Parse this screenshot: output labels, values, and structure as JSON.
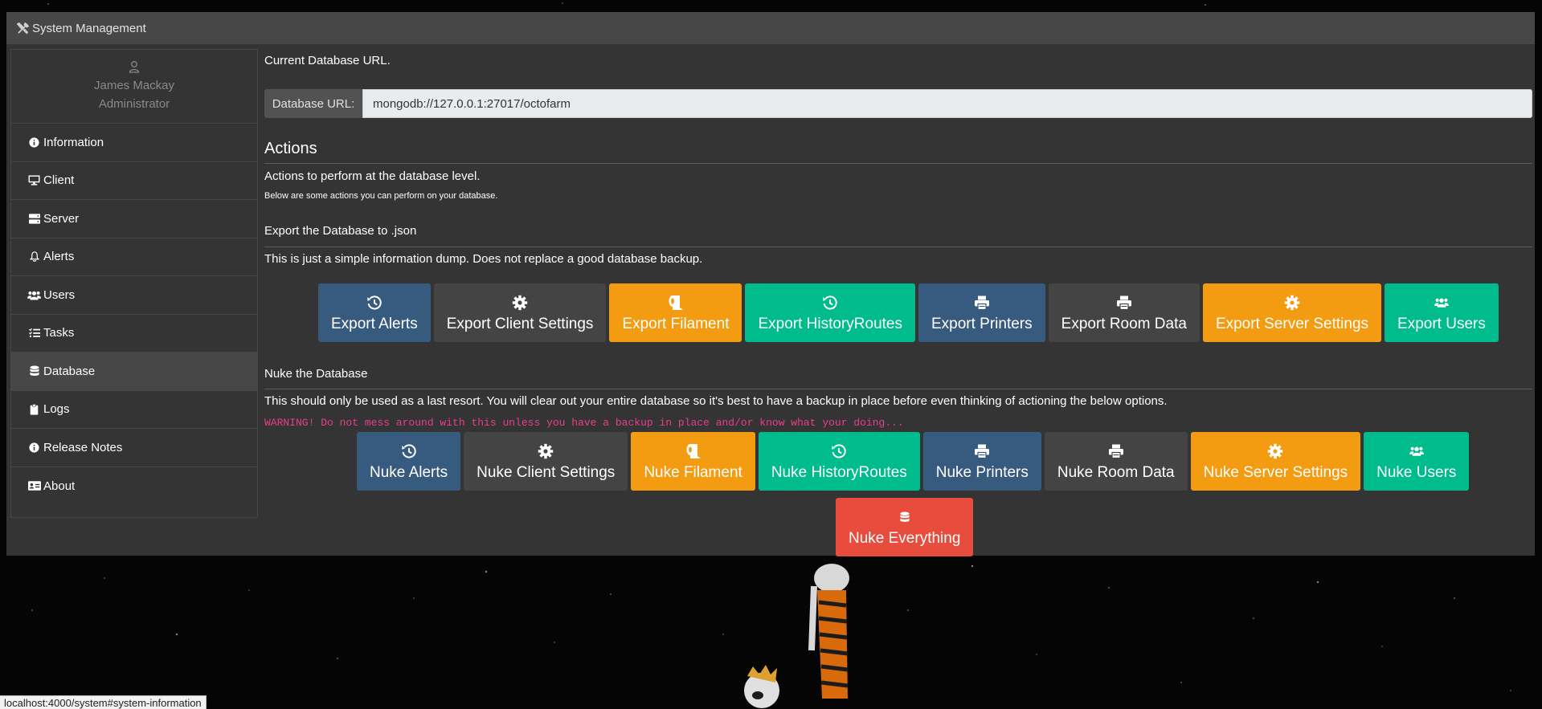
{
  "modal": {
    "title": "System Management",
    "title_icon": "tools-icon"
  },
  "profile": {
    "name": "James Mackay",
    "role": "Administrator",
    "icon": "user-icon"
  },
  "sidebar": {
    "items": [
      {
        "label": "Information",
        "icon": "info-circle-icon"
      },
      {
        "label": "Client",
        "icon": "desktop-icon"
      },
      {
        "label": "Server",
        "icon": "server-icon"
      },
      {
        "label": "Alerts",
        "icon": "bell-icon"
      },
      {
        "label": "Users",
        "icon": "users-icon"
      },
      {
        "label": "Tasks",
        "icon": "tasks-icon"
      },
      {
        "label": "Database",
        "icon": "database-icon",
        "active": true
      },
      {
        "label": "Logs",
        "icon": "clipboard-icon"
      },
      {
        "label": "Release Notes",
        "icon": "info-circle-icon"
      },
      {
        "label": "About",
        "icon": "id-card-icon"
      }
    ]
  },
  "database": {
    "current_url_label": "Current Database URL.",
    "prefix": "Database URL:",
    "url": "mongodb://127.0.0.1:27017/octofarm"
  },
  "actions": {
    "heading": "Actions",
    "subheading": "Actions to perform at the database level.",
    "note": "Below are some actions you can perform on your database."
  },
  "export": {
    "heading": "Export the Database to .json",
    "description": "This is just a simple information dump. Does not replace a good database backup.",
    "buttons": [
      {
        "label": "Export Alerts",
        "icon": "history-icon",
        "color": "#375a7f"
      },
      {
        "label": "Export Client Settings",
        "icon": "cog-icon",
        "color": "#444444"
      },
      {
        "label": "Export Filament",
        "icon": "toilet-paper-icon",
        "color": "#f39c12"
      },
      {
        "label": "Export HistoryRoutes",
        "icon": "history-icon",
        "color": "#00bc8c"
      },
      {
        "label": "Export Printers",
        "icon": "print-icon",
        "color": "#375a7f"
      },
      {
        "label": "Export Room Data",
        "icon": "print-icon",
        "color": "#444444"
      },
      {
        "label": "Export Server Settings",
        "icon": "cog-icon",
        "color": "#f39c12"
      },
      {
        "label": "Export Users",
        "icon": "users-icon",
        "color": "#00bc8c"
      }
    ]
  },
  "nuke": {
    "heading": "Nuke the Database",
    "description": "This should only be used as a last resort. You will clear out your entire database so it's best to have a backup in place before even thinking of actioning the below options.",
    "warning": "WARNING! Do not mess around with this unless you have a backup in place and/or know what your doing...",
    "buttons": [
      {
        "label": "Nuke Alerts",
        "icon": "history-icon",
        "color": "#375a7f"
      },
      {
        "label": "Nuke Client Settings",
        "icon": "cog-icon",
        "color": "#444444"
      },
      {
        "label": "Nuke Filament",
        "icon": "toilet-paper-icon",
        "color": "#f39c12"
      },
      {
        "label": "Nuke HistoryRoutes",
        "icon": "history-icon",
        "color": "#00bc8c"
      },
      {
        "label": "Nuke Printers",
        "icon": "print-icon",
        "color": "#375a7f"
      },
      {
        "label": "Nuke Room Data",
        "icon": "print-icon",
        "color": "#444444"
      },
      {
        "label": "Nuke Server Settings",
        "icon": "cog-icon",
        "color": "#f39c12"
      },
      {
        "label": "Nuke Users",
        "icon": "users-icon",
        "color": "#00bc8c"
      }
    ],
    "everything": {
      "label": "Nuke Everything",
      "icon": "database-icon",
      "color": "#e74c3c"
    }
  },
  "status_bar": {
    "url": "localhost:4000/system#system-information"
  }
}
